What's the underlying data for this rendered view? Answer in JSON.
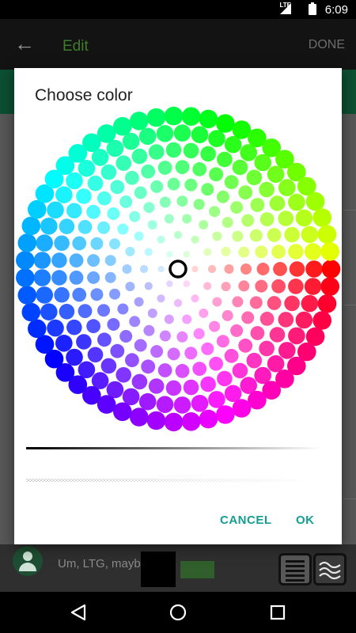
{
  "status_bar": {
    "network": "LTE",
    "time": "6:09"
  },
  "app_bar": {
    "title": "Edit",
    "done_label": "DONE"
  },
  "dialog": {
    "title": "Choose color",
    "cancel_label": "CANCEL",
    "ok_label": "OK",
    "selected_color": "#ffffff"
  },
  "message": {
    "preview_text": "Um, LTG, mayb"
  },
  "colors": {
    "accent": "#169d91",
    "app_green": "#3f7d2a"
  },
  "icons": [
    "back-arrow-icon",
    "signal-icon",
    "battery-icon",
    "avatar-icon",
    "keyboard-icon",
    "wave-icon",
    "nav-back-icon",
    "nav-home-icon",
    "nav-recents-icon"
  ]
}
